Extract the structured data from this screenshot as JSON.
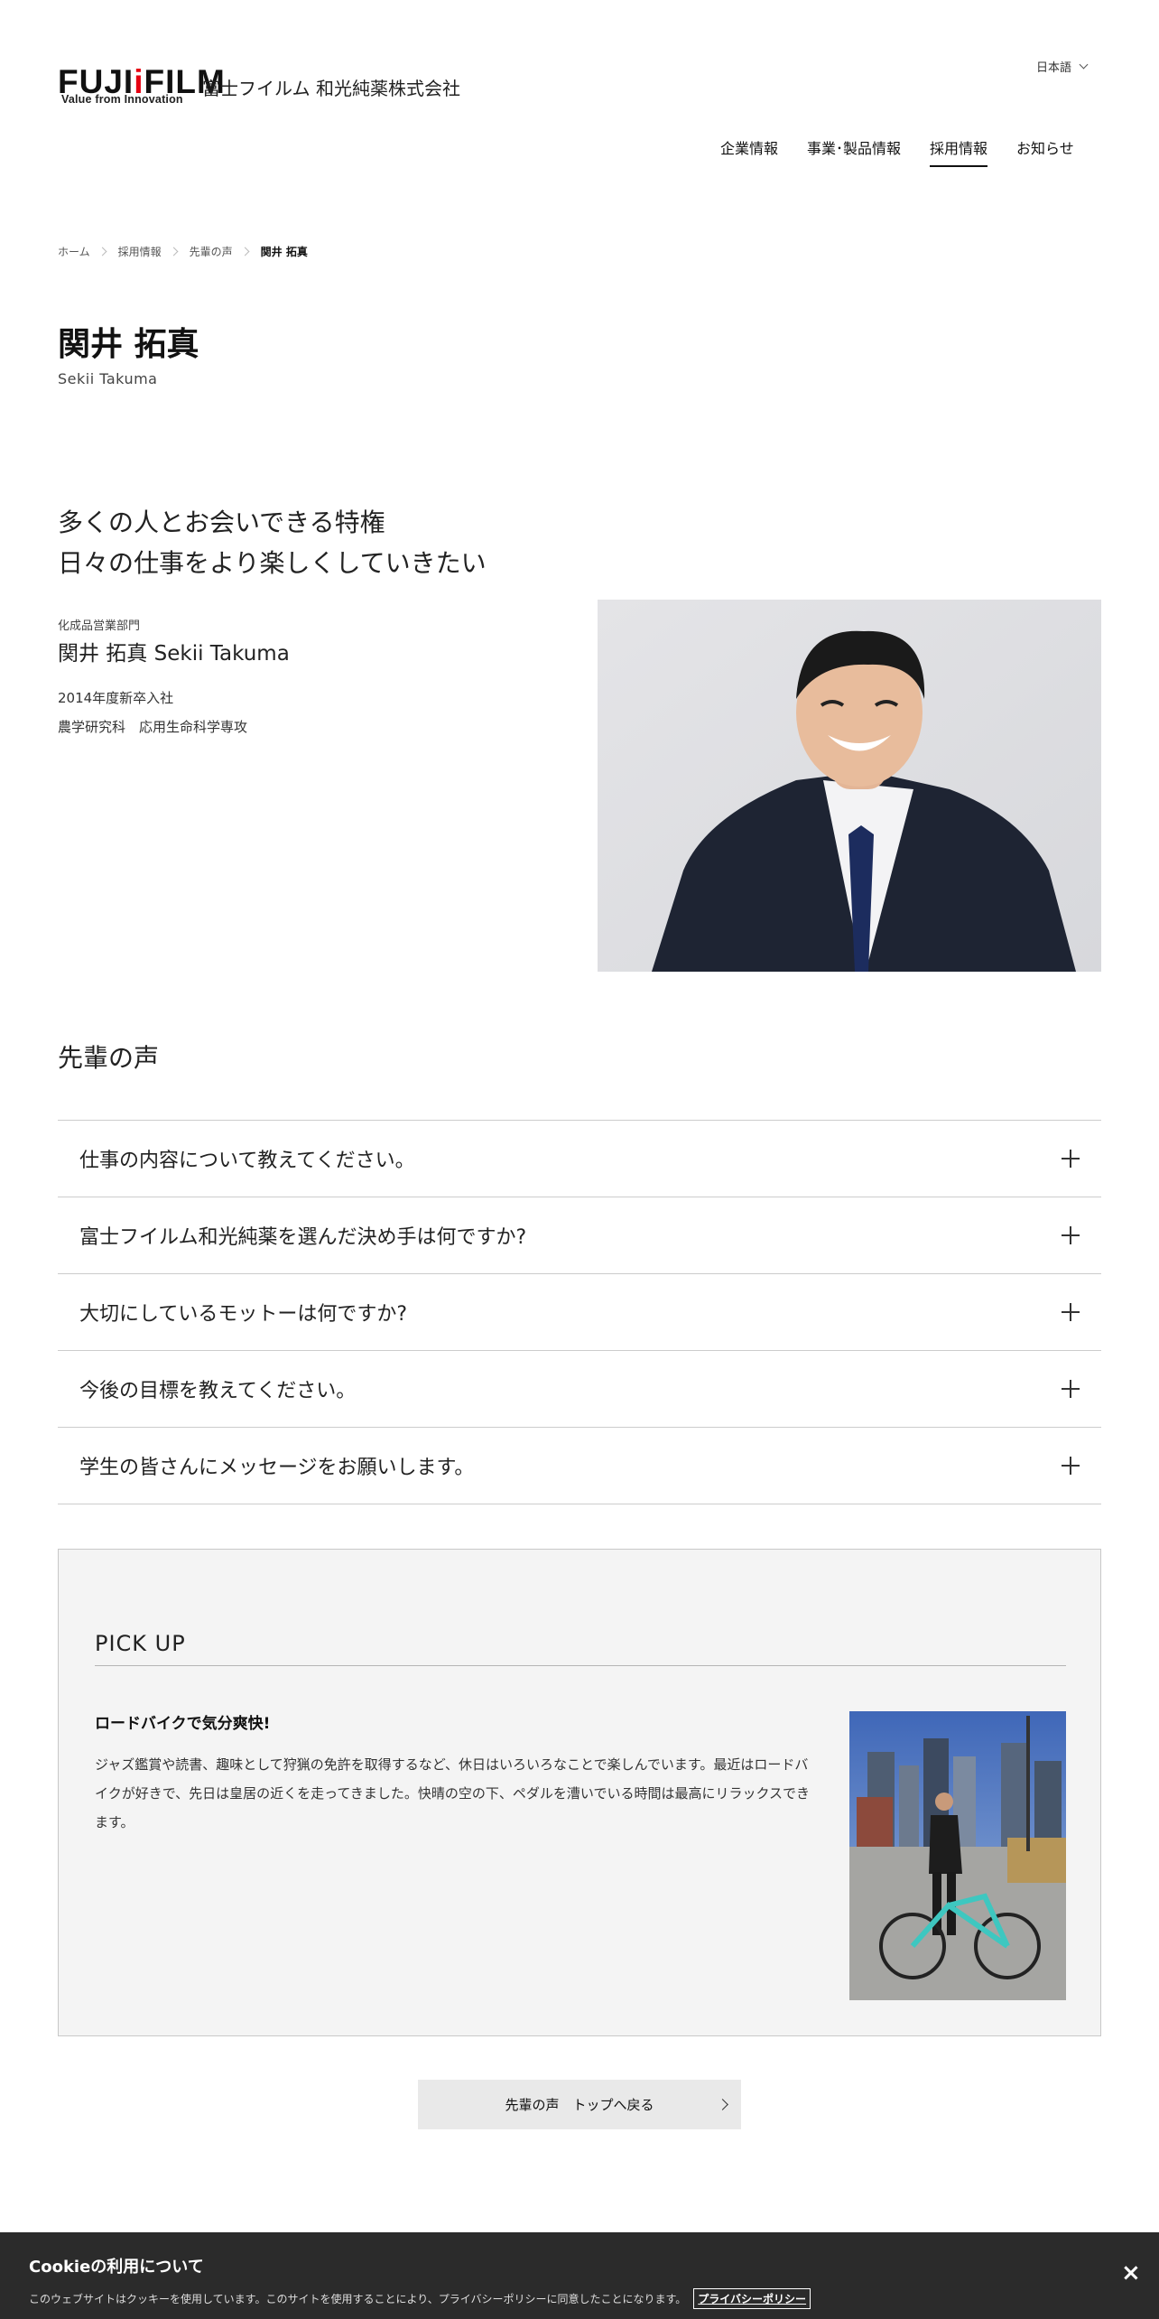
{
  "header": {
    "logo_fuji": "FUJI",
    "logo_film": "FILM",
    "logo_tagline": "Value from Innovation",
    "company_name": "富士フイルム 和光純薬株式会社",
    "language": "日本語",
    "nav": [
      "企業情報",
      "事業･製品情報",
      "採用情報",
      "お知らせ"
    ],
    "active_nav": "採用情報"
  },
  "breadcrumb": [
    "ホーム",
    "採用情報",
    "先輩の声",
    "関井 拓真"
  ],
  "profile": {
    "name_ja": "関井 拓真",
    "name_en": "Sekii Takuma",
    "headline_1": "多くの人とお会いできる特権",
    "headline_2": "日々の仕事をより楽しくしていきたい",
    "department": "化成品営業部門",
    "full_name": "関井 拓真 Sekii Takuma",
    "joined": "2014年度新卒入社",
    "education": "農学研究科　応用生命科学専攻"
  },
  "voices": {
    "title": "先輩の声",
    "questions": [
      "仕事の内容について教えてください。",
      "富士フイルム和光純薬を選んだ決め手は何ですか?",
      "大切にしているモットーは何ですか?",
      "今後の目標を教えてください。",
      "学生の皆さんにメッセージをお願いします。"
    ]
  },
  "pickup": {
    "title": "PICK UP",
    "subtitle": "ロードバイクで気分爽快!",
    "body": "ジャズ鑑賞や読書、趣味として狩猟の免許を取得するなど、休日はいろいろなことで楽しんでいます。最近はロードバイクが好きで、先日は皇居の近くを走ってきました。快晴の空の下、ペダルを漕いでいる時間は最高にリラックスできます。"
  },
  "back_button": "先輩の声　トップへ戻る",
  "cookie": {
    "title": "Cookieの利用について",
    "text": "このウェブサイトはクッキーを使用しています。このサイトを使用することにより、プライバシーポリシーに同意したことになります。",
    "link": "プライバシーポリシー",
    "close": "×"
  }
}
